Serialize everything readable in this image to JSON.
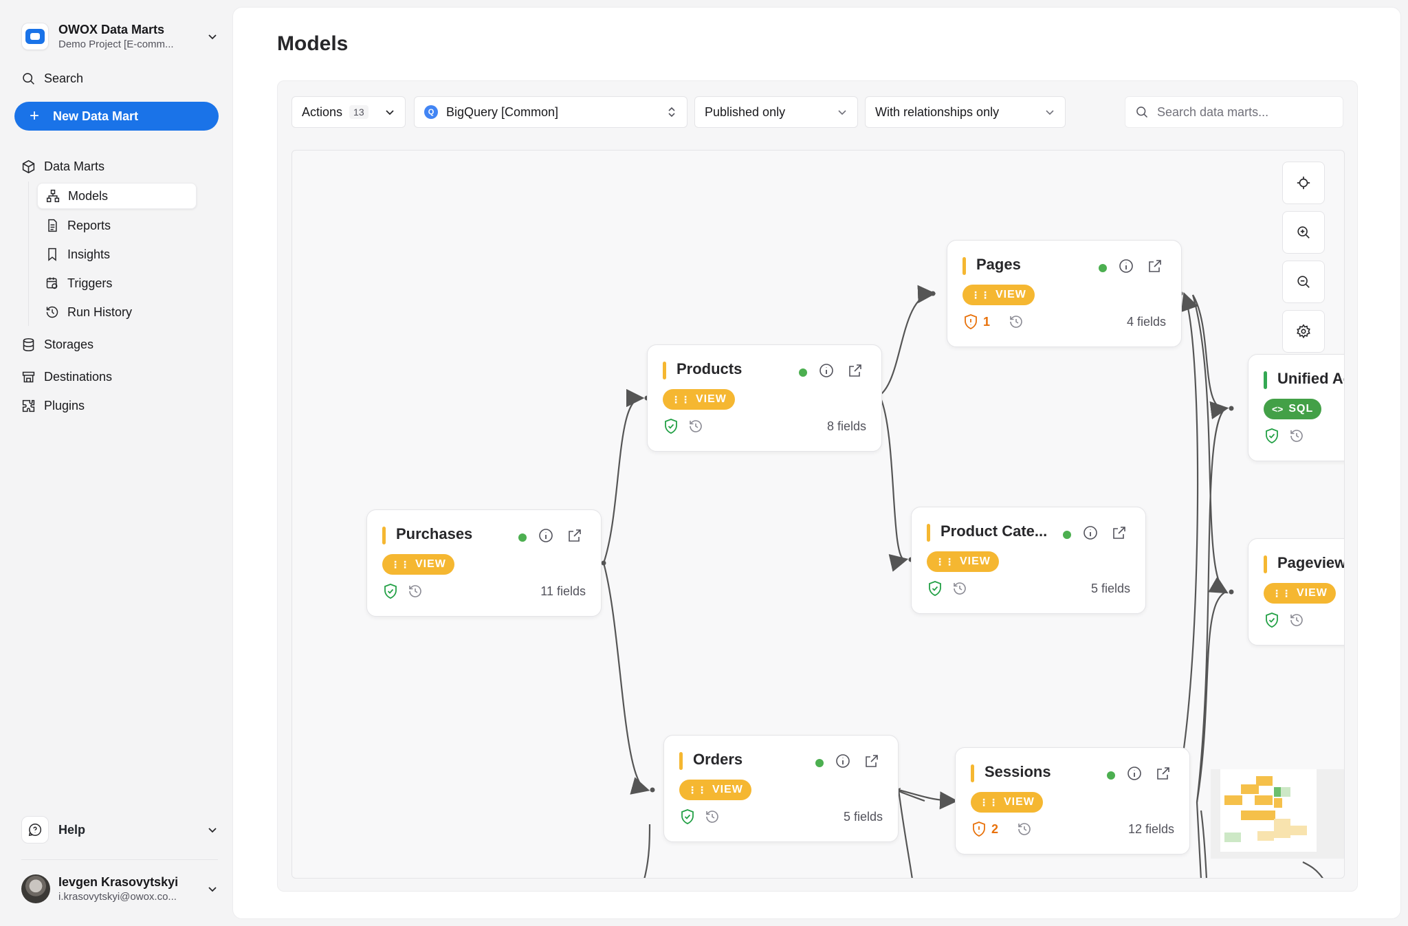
{
  "sidebar": {
    "project": {
      "name": "OWOX Data Marts",
      "sub": "Demo Project [E-comm..."
    },
    "search_label": "Search",
    "new_button": "New Data Mart",
    "data_marts": "Data Marts",
    "sub_items": [
      "Models",
      "Reports",
      "Insights",
      "Triggers",
      "Run History"
    ],
    "storages": "Storages",
    "destinations": "Destinations",
    "plugins": "Plugins",
    "help": "Help",
    "user": {
      "name": "Ievgen Krasovytskyi",
      "email": "i.krasovytskyi@owox.co..."
    }
  },
  "page": {
    "title": "Models"
  },
  "toolbar": {
    "actions_label": "Actions",
    "actions_count": "13",
    "storage_select": "BigQuery [Common]",
    "published_filter": "Published only",
    "relationship_filter": "With relationships only",
    "search_placeholder": "Search data marts..."
  },
  "nodes": {
    "purchases": {
      "name": "Purchases",
      "tag": "VIEW",
      "fields": "11 fields"
    },
    "products": {
      "name": "Products",
      "tag": "VIEW",
      "fields": "8 fields"
    },
    "pages": {
      "name": "Pages",
      "tag": "VIEW",
      "fields": "4 fields",
      "warnings": "1"
    },
    "product_categories": {
      "name": "Product Cate...",
      "tag": "VIEW",
      "fields": "5 fields"
    },
    "orders": {
      "name": "Orders",
      "tag": "VIEW",
      "fields": "5 fields"
    },
    "sessions": {
      "name": "Sessions",
      "tag": "VIEW",
      "fields": "12 fields",
      "warnings": "2"
    },
    "unified": {
      "name": "Unified Ac",
      "tag": "SQL"
    },
    "pageviews": {
      "name": "Pageviews",
      "tag": "VIEW"
    }
  },
  "colors": {
    "accent": "#1a73e8",
    "view_tag": "#f5b731",
    "sql_tag": "#43a047",
    "status_ok": "#4caf50",
    "warning": "#e8710a"
  }
}
